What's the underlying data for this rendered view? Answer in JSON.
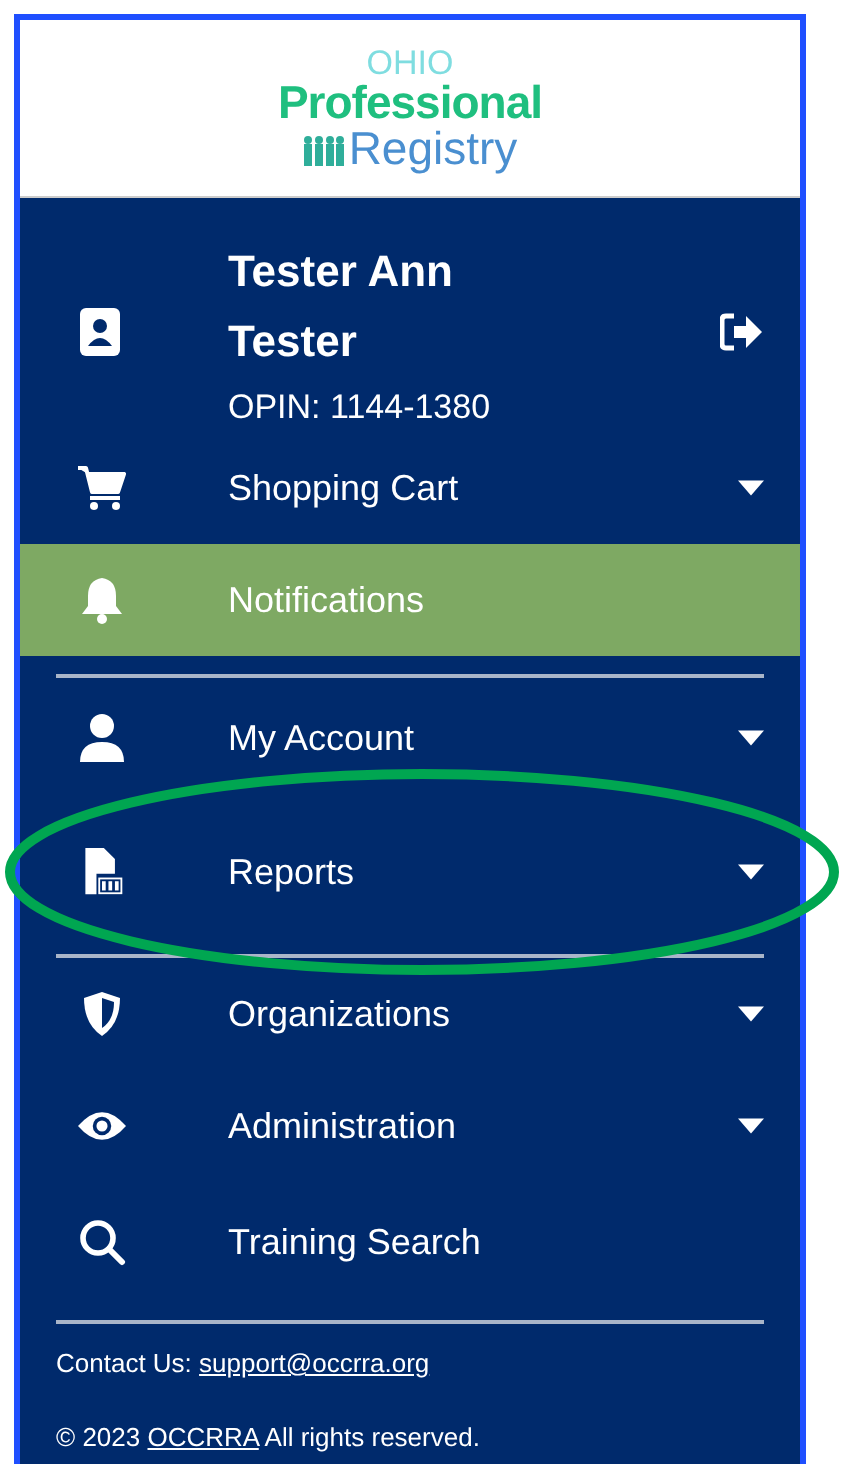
{
  "logo": {
    "top": "OHIO",
    "middle": "Professional",
    "bottom": "Registry"
  },
  "user": {
    "name": "Tester Ann Tester",
    "opin": "OPIN: 1144-1380"
  },
  "menu_sections": [
    {
      "items": [
        {
          "label": "Shopping Cart",
          "has_dropdown": true,
          "selected": false
        },
        {
          "label": "Notifications",
          "has_dropdown": false,
          "selected": true
        }
      ]
    },
    {
      "items": [
        {
          "label": "My Account",
          "has_dropdown": true,
          "selected": false
        },
        {
          "label": "Reports",
          "has_dropdown": true,
          "selected": false
        }
      ]
    },
    {
      "items": [
        {
          "label": "Organizations",
          "has_dropdown": true,
          "selected": false
        },
        {
          "label": "Administration",
          "has_dropdown": true,
          "selected": false
        },
        {
          "label": "Training Search",
          "has_dropdown": false,
          "selected": false
        }
      ]
    }
  ],
  "footer": {
    "contact_label": "Contact Us:",
    "contact_email": "support@occrra.org",
    "copyright": "© 2023",
    "org_link": "OCCRRA",
    "rights": "All rights reserved."
  }
}
